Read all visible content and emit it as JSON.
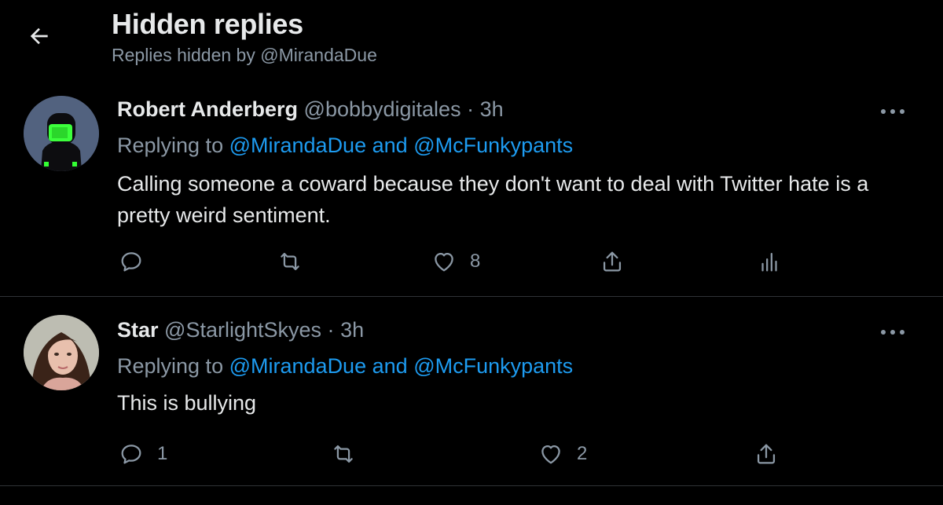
{
  "header": {
    "title": "Hidden replies",
    "subtitle": "Replies hidden by @MirandaDue"
  },
  "replies": [
    {
      "display_name": "Robert Anderberg",
      "handle": "@bobbydigitales",
      "separator": "·",
      "time": "3h",
      "replying_prefix": "Replying to",
      "mention_1": "@MirandaDue",
      "conjunction": "and",
      "mention_2": "@McFunkypants",
      "text": "Calling someone a coward because they don't want to deal with Twitter hate is a pretty weird sentiment.",
      "reply_count": "",
      "retweet_count": "",
      "like_count": "8",
      "avatar_icon": "avatar-green-helmet",
      "actions": [
        "reply-icon",
        "retweet-icon",
        "like-icon",
        "share-icon",
        "analytics-icon"
      ]
    },
    {
      "display_name": "Star",
      "handle": "@StarlightSkyes",
      "separator": "·",
      "time": "3h",
      "replying_prefix": "Replying to",
      "mention_1": "@MirandaDue",
      "conjunction": "and",
      "mention_2": "@McFunkypants",
      "text": "This is bullying",
      "reply_count": "1",
      "retweet_count": "",
      "like_count": "2",
      "avatar_icon": "avatar-photo",
      "actions": [
        "reply-icon",
        "retweet-icon",
        "like-icon",
        "share-icon"
      ]
    }
  ],
  "colors": {
    "background": "#000000",
    "primary_text": "#e7e9ea",
    "secondary_text": "#8b98a5",
    "link": "#1d9bf0",
    "divider": "#2f3336"
  }
}
